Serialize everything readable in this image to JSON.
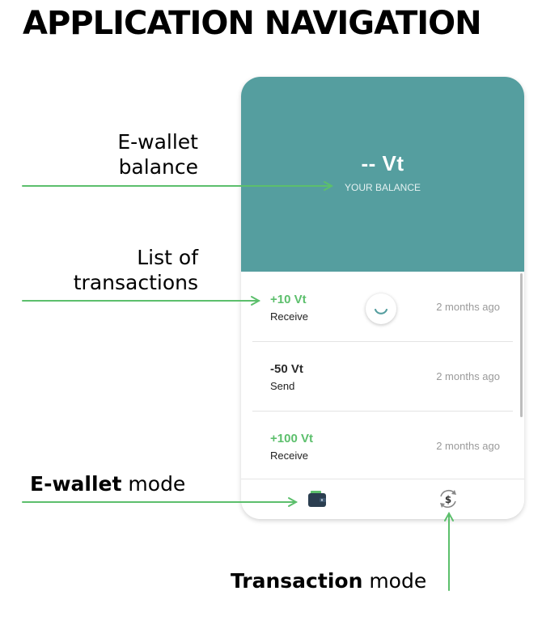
{
  "title": "APPLICATION NAVIGATION",
  "annotations": {
    "balance": "E-wallet balance",
    "transactions": "List of transactions",
    "wallet_mode_bold": "E-wallet",
    "wallet_mode_rest": " mode",
    "transaction_mode_bold": "Transaction",
    "transaction_mode_rest": " mode"
  },
  "app": {
    "balance_amount": "-- Vt",
    "balance_caption": "YOUR BALANCE",
    "transactions": [
      {
        "amount": "+10 Vt",
        "type": "Receive",
        "time": "2 months ago",
        "sign": "pos"
      },
      {
        "amount": "-50 Vt",
        "type": "Send",
        "time": "2 months ago",
        "sign": "neg"
      },
      {
        "amount": "+100 Vt",
        "type": "Receive",
        "time": "2 months ago",
        "sign": "pos"
      }
    ],
    "tabs": [
      {
        "icon": "wallet-icon",
        "mode": "e-wallet"
      },
      {
        "icon": "dollar-refresh-icon",
        "mode": "transaction"
      }
    ]
  },
  "colors": {
    "header": "#559e9f",
    "positive": "#5cbf6c",
    "arrow": "#5cbf6c"
  }
}
